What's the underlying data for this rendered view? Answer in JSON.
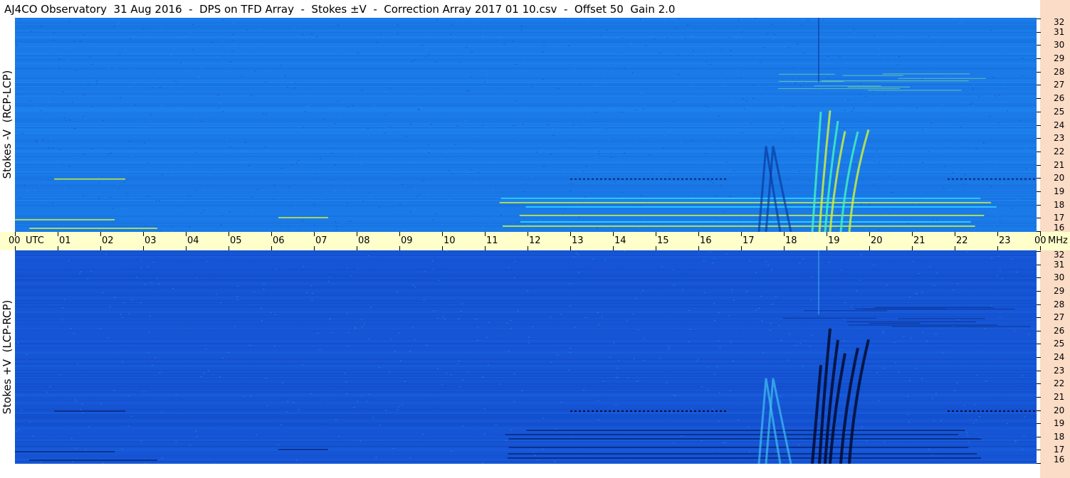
{
  "title": "AJ4CO Observatory  31 Aug 2016  -  DPS on TFD Array  -  Stokes ±V  -  Correction Array 2017 01 10.csv  -  Offset 50  Gain 2.0",
  "colors": {
    "background_blue": "#1a78e6",
    "dark_blue": "#0a3aa0",
    "cyan": "#30d8ff",
    "yellow_green": "#c8f040",
    "time_strip": "#ffffcc",
    "freq_strip": "#fbdcc6"
  },
  "chart_data": [
    {
      "type": "heatmap",
      "name": "top-panel",
      "ylabel": "Stokes -V  (RCP-LCP)",
      "xlabel": "UTC",
      "x_unit": "UTC",
      "y_unit": "MHz",
      "xlim": [
        0,
        24
      ],
      "ylim": [
        16,
        32
      ],
      "x_ticks": [
        "00",
        "01",
        "02",
        "03",
        "04",
        "05",
        "06",
        "07",
        "08",
        "09",
        "10",
        "11",
        "12",
        "13",
        "14",
        "15",
        "16",
        "17",
        "18",
        "19",
        "20",
        "21",
        "22",
        "23",
        "00"
      ],
      "y_ticks": [
        "16",
        "17",
        "18",
        "19",
        "20",
        "21",
        "22",
        "23",
        "24",
        "25",
        "26",
        "27",
        "28",
        "29",
        "30",
        "31",
        "32"
      ]
    },
    {
      "type": "heatmap",
      "name": "bottom-panel",
      "ylabel": "Stokes +V  (LCP-RCP)",
      "xlabel": "UTC",
      "x_unit": "UTC",
      "y_unit": "MHz",
      "xlim": [
        0,
        24
      ],
      "ylim": [
        16,
        32
      ],
      "x_ticks": [
        "00",
        "01",
        "02",
        "03",
        "04",
        "05",
        "06",
        "07",
        "08",
        "09",
        "10",
        "11",
        "12",
        "13",
        "14",
        "15",
        "16",
        "17",
        "18",
        "19",
        "20",
        "21",
        "22",
        "23",
        "00"
      ],
      "y_ticks": [
        "16",
        "17",
        "18",
        "19",
        "20",
        "21",
        "22",
        "23",
        "24",
        "25",
        "26",
        "27",
        "28",
        "29",
        "30",
        "31",
        "32"
      ]
    }
  ],
  "time_axis": {
    "utc_label": "UTC",
    "mhz_label": "MHz"
  }
}
